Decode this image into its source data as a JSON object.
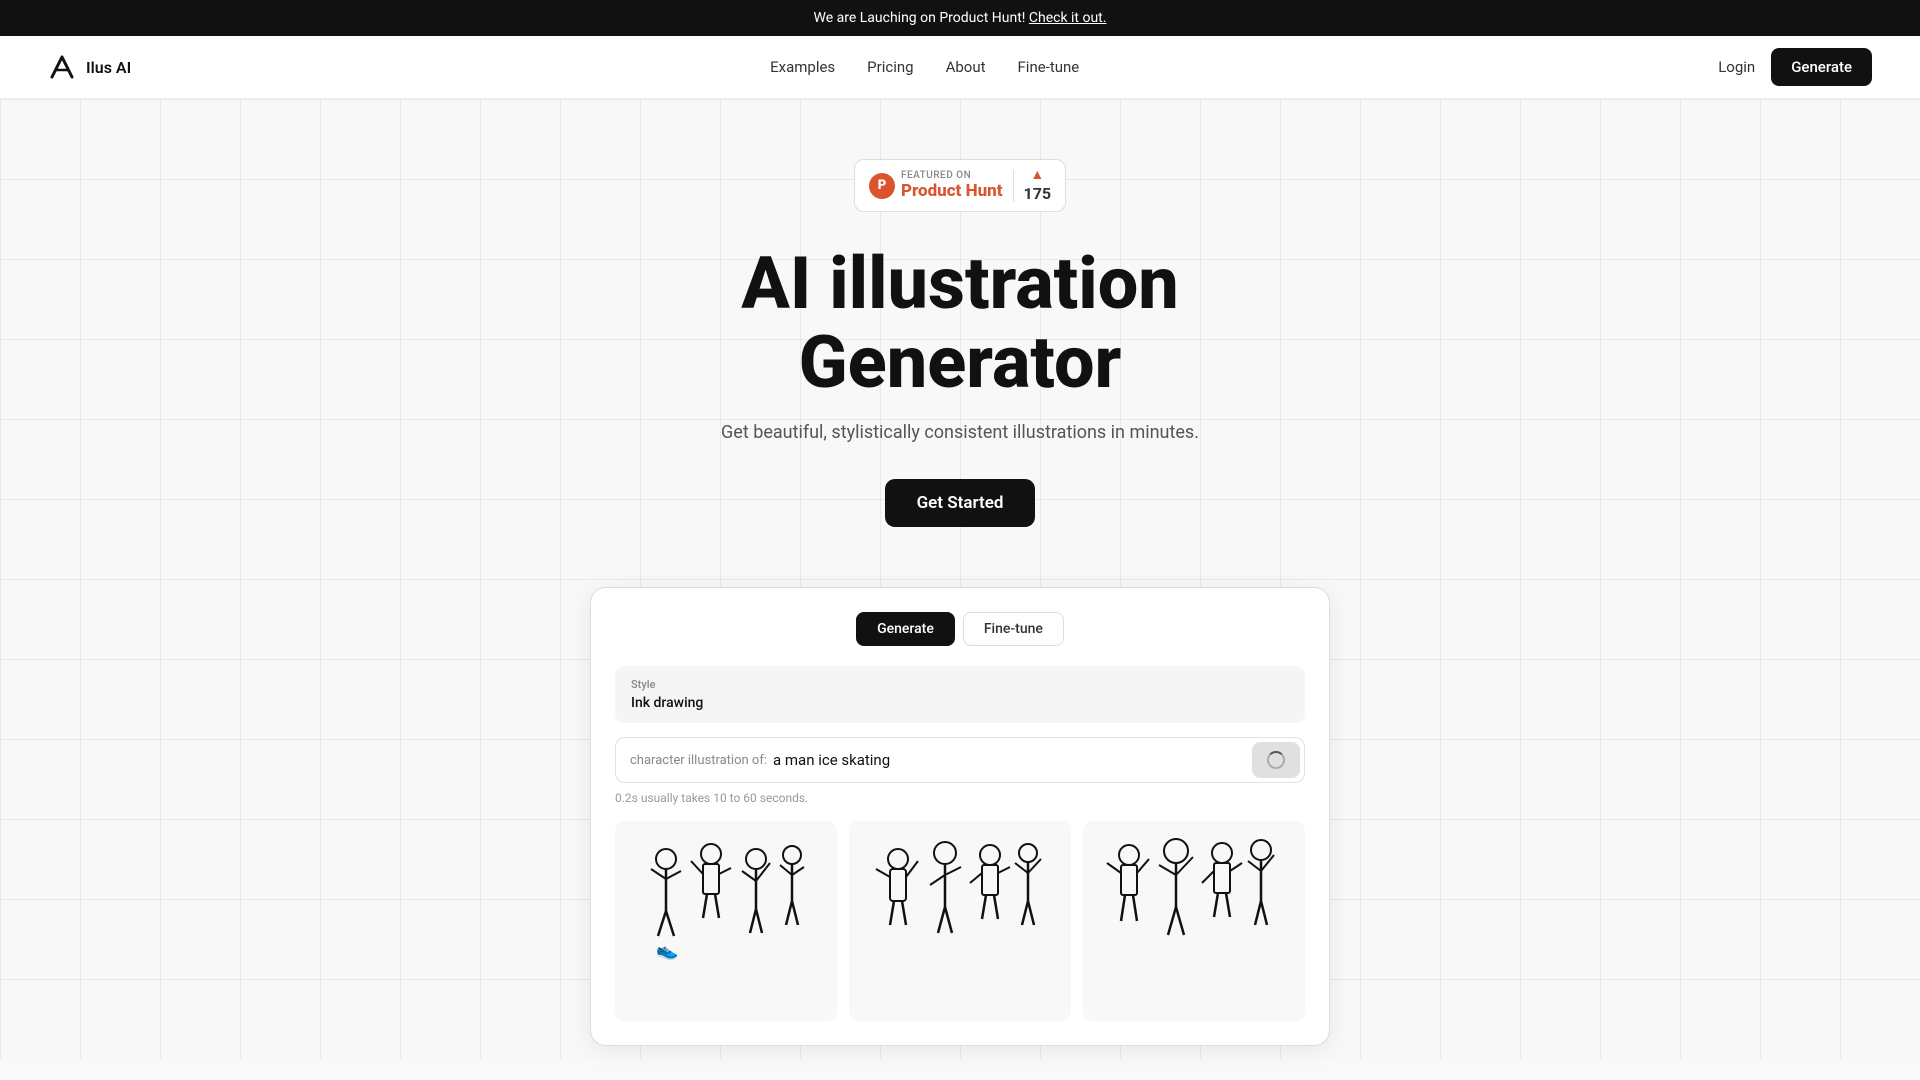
{
  "announcement": {
    "text": "We are Lauching on Product Hunt!",
    "link_text": "Check it out.",
    "link_href": "#"
  },
  "navbar": {
    "logo_text": "Ilus AI",
    "nav_links": [
      {
        "label": "Examples",
        "key": "examples"
      },
      {
        "label": "Pricing",
        "key": "pricing"
      },
      {
        "label": "About",
        "key": "about"
      },
      {
        "label": "Fine-tune",
        "key": "fine-tune"
      }
    ],
    "login_label": "Login",
    "generate_label": "Generate"
  },
  "product_hunt": {
    "featured_text": "FEATURED ON",
    "brand_name": "Product Hunt",
    "vote_count": "175"
  },
  "hero": {
    "title_line1": "AI illustration",
    "title_line2": "Generator",
    "subtitle": "Get beautiful, stylistically consistent illustrations in minutes.",
    "cta_label": "Get Started"
  },
  "app_preview": {
    "tab_generate": "Generate",
    "tab_finetune": "Fine-tune",
    "style_label": "Style",
    "style_value": "Ink drawing",
    "prompt_prefix": "character illustration of:",
    "prompt_text": "a man ice skating",
    "timing_text": "0.2s usually takes 10 to 60 seconds."
  }
}
